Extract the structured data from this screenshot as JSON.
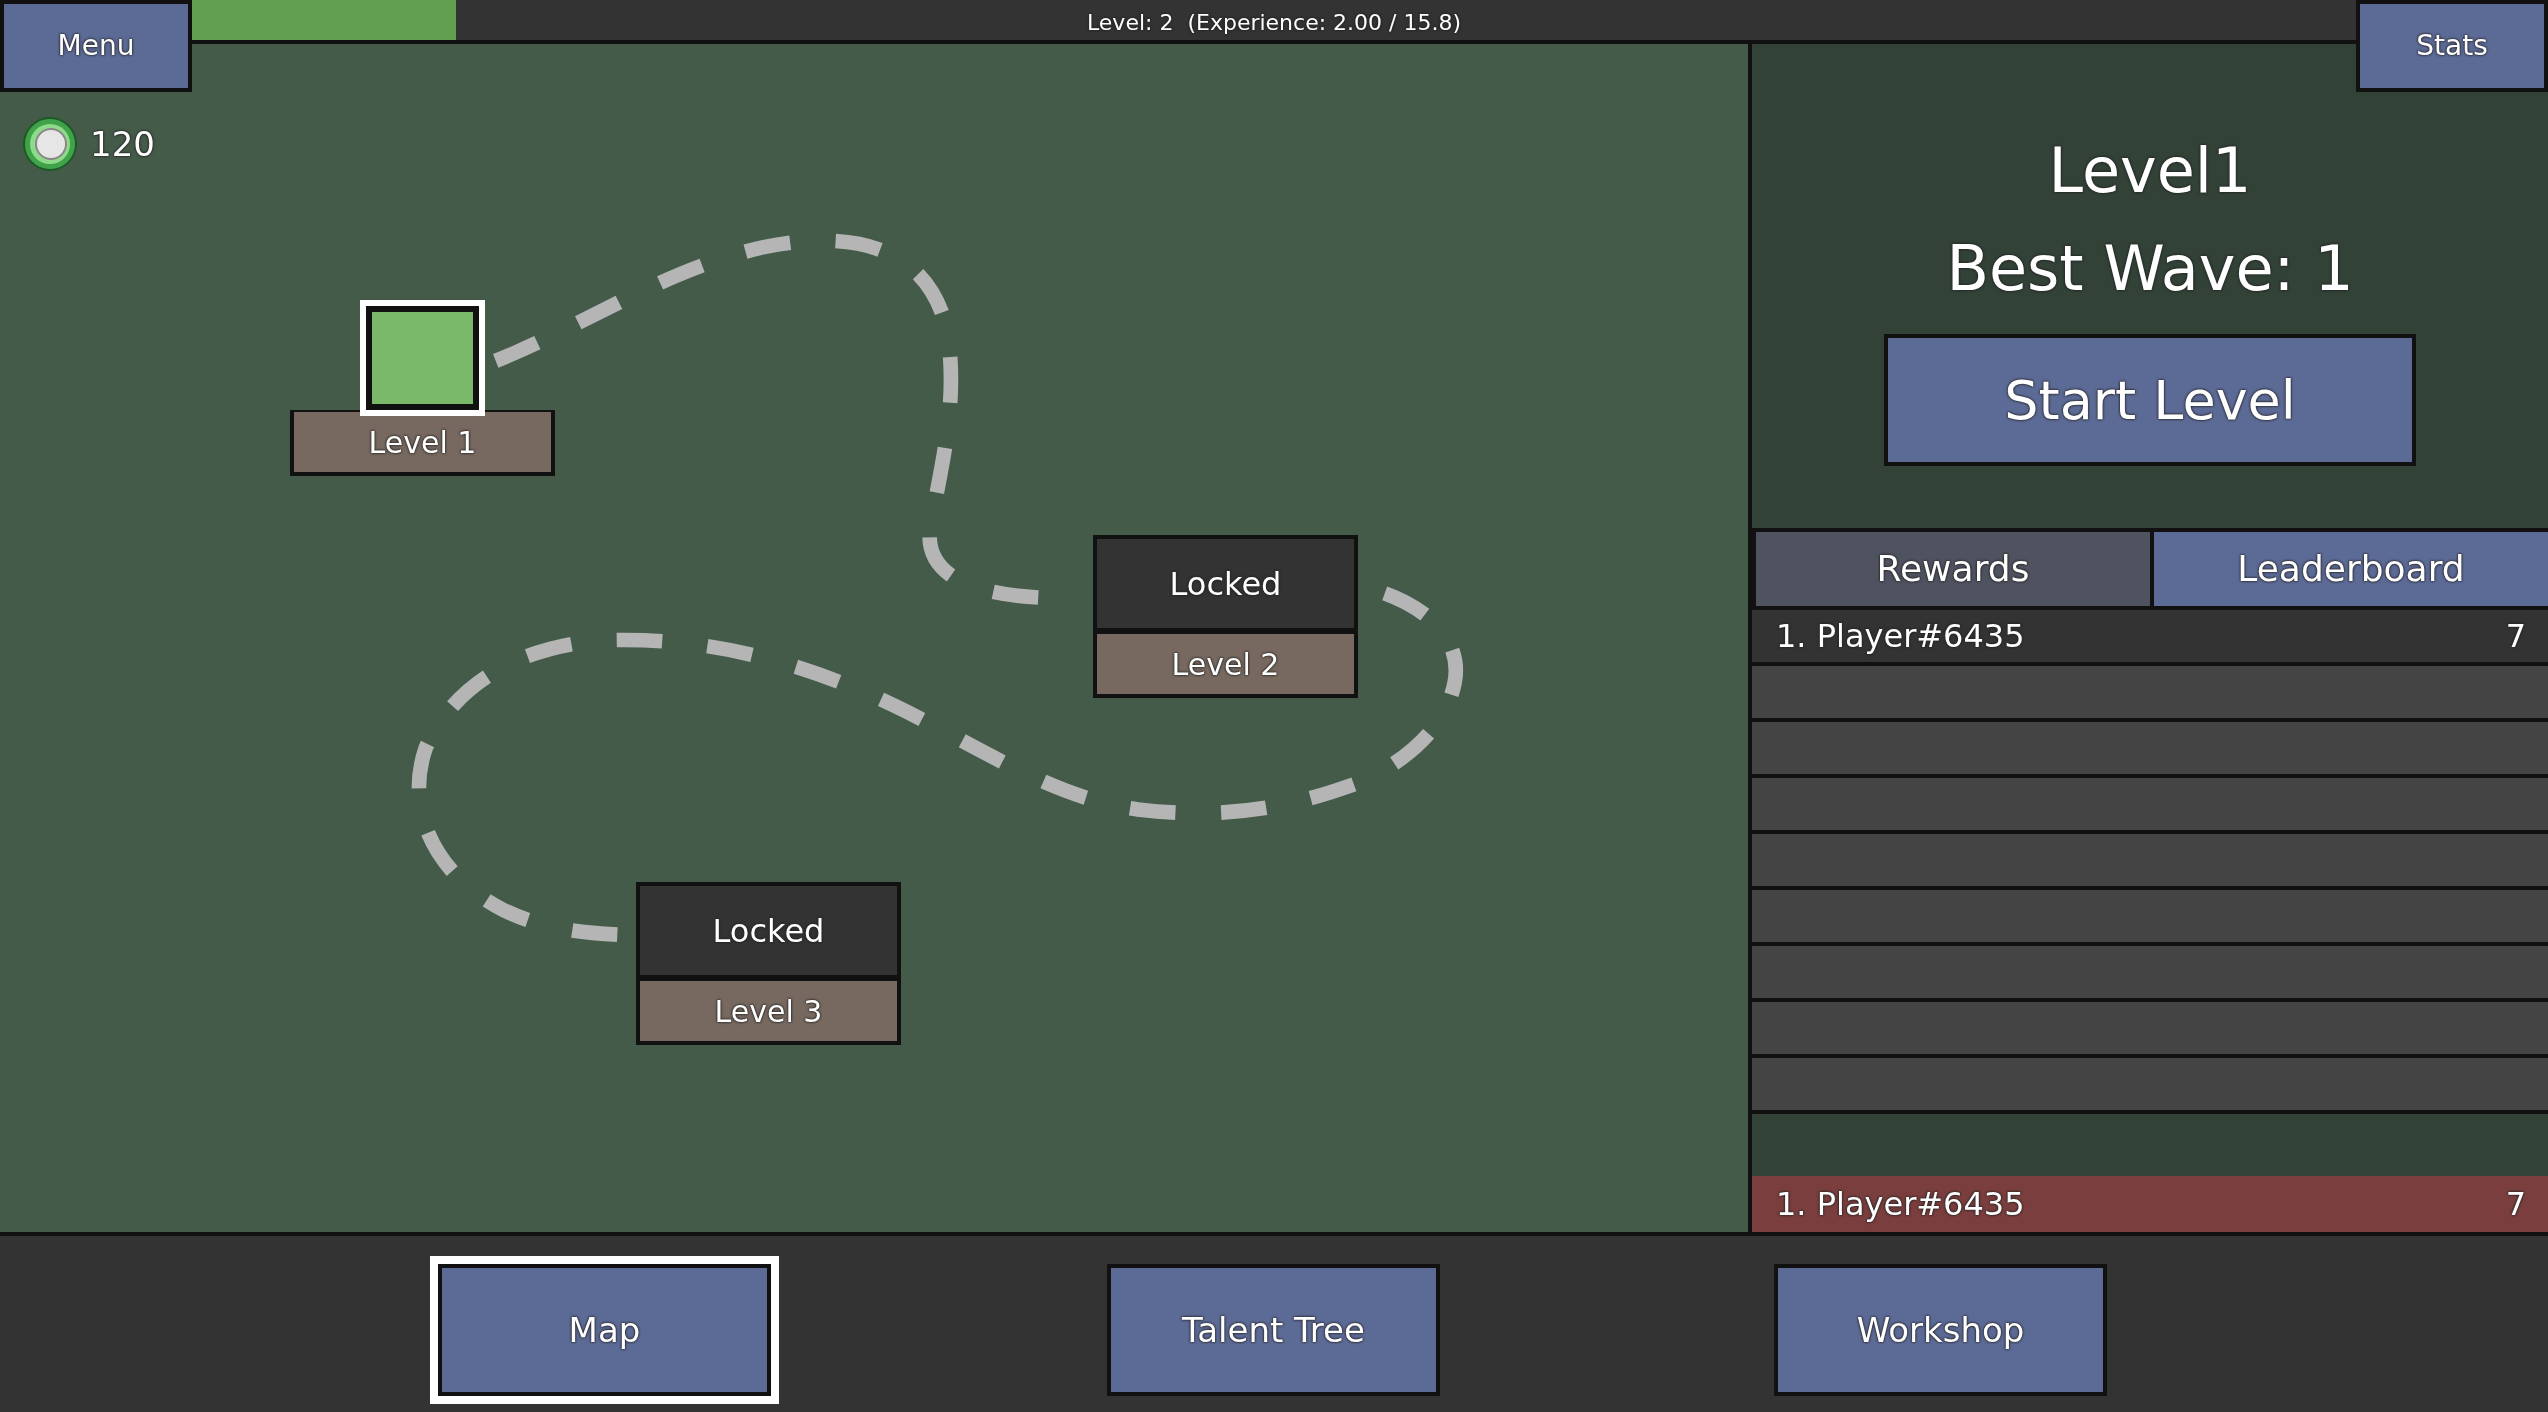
{
  "menu_button": "Menu",
  "experience": {
    "label": "Level: 2  (Experience: 2.00 / 15.8)",
    "level": 0.124
  },
  "stats_button": "Stats",
  "currency": {
    "amount": "120"
  },
  "map_nodes": [
    {
      "label": "Level 1",
      "locked": false,
      "selected": true
    },
    {
      "label": "Level 2",
      "locked": true,
      "lock_text": "Locked",
      "selected": false
    },
    {
      "label": "Level 3",
      "locked": true,
      "lock_text": "Locked",
      "selected": false
    }
  ],
  "detail": {
    "title": "Level1",
    "best_wave": "Best Wave: 1",
    "start_button": "Start Level"
  },
  "tabs": [
    {
      "label": "Rewards",
      "selected": false
    },
    {
      "label": "Leaderboard",
      "selected": true
    }
  ],
  "leaderboard": {
    "rows": [
      {
        "name": "1. Player#6435",
        "score": "7"
      }
    ],
    "own_row": {
      "name": "1. Player#6435",
      "score": "7"
    }
  },
  "bottom_nav": [
    {
      "label": "Map",
      "selected": true
    },
    {
      "label": "Talent Tree",
      "selected": false
    },
    {
      "label": "Workshop",
      "selected": false
    }
  ]
}
